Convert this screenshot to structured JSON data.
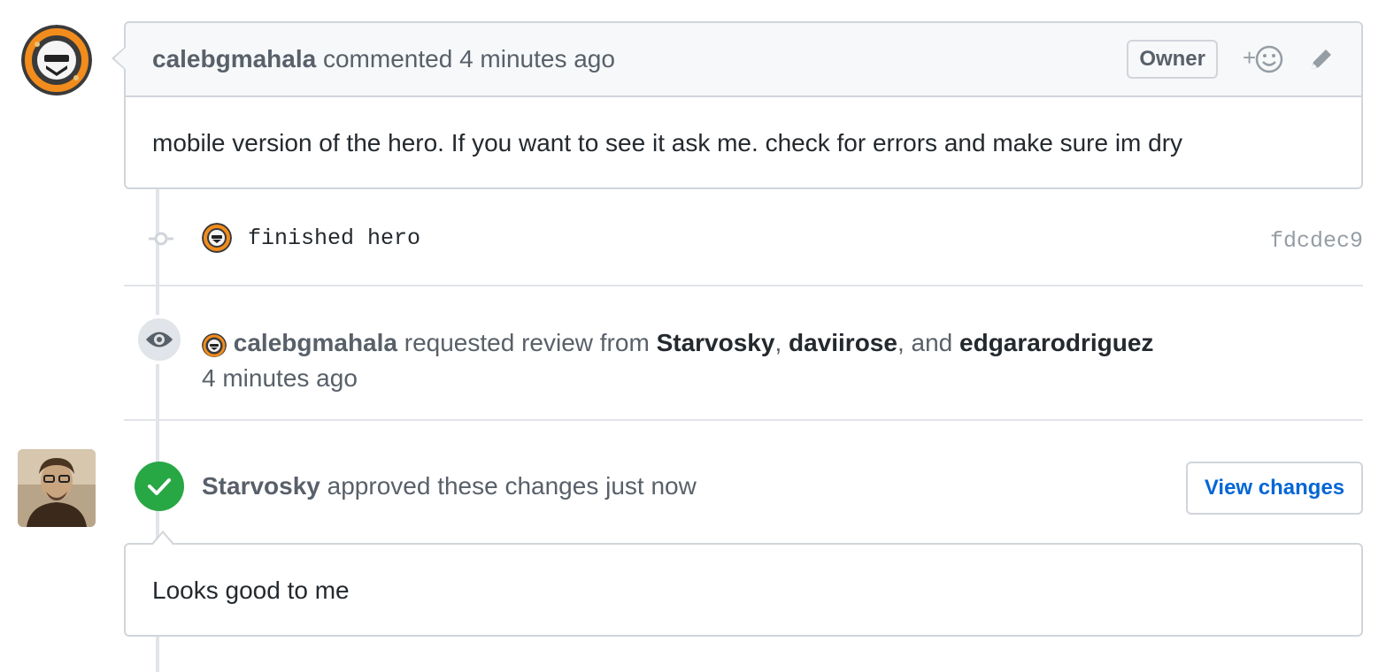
{
  "comment": {
    "author": "calebgmahala",
    "action": "commented",
    "time": "4 minutes ago",
    "badge": "Owner",
    "body": "mobile version of the hero. If you want to see it ask me. check for errors and make sure im dry",
    "icons": [
      "add-reaction-icon",
      "edit-pencil-icon"
    ]
  },
  "commit": {
    "message": "finished hero",
    "sha": "fdcdec9"
  },
  "review_request": {
    "author": "calebgmahala",
    "text": "requested review from",
    "reviewers": [
      "Starvosky",
      "daviirose",
      "edgararodriguez"
    ],
    "separator1": ",",
    "separator2": ", and",
    "time": "4 minutes ago"
  },
  "approval": {
    "author": "Starvosky",
    "text": "approved these changes just now",
    "button_label": "View changes",
    "body": "Looks good to me"
  },
  "colors": {
    "approved_green": "#28a745",
    "link_blue": "#0366d6",
    "border": "#d1d5da",
    "muted": "#586069"
  }
}
